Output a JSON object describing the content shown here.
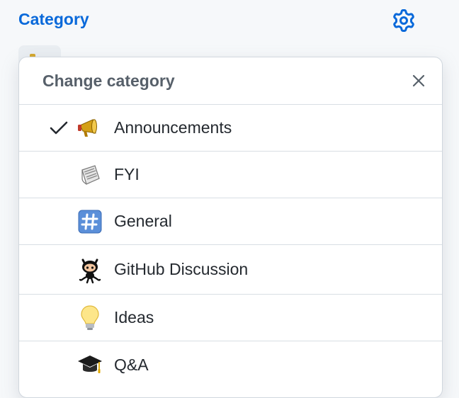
{
  "sidebar": {
    "heading": "Category"
  },
  "menu": {
    "title": "Change category",
    "items": [
      {
        "label": "Announcements",
        "emoji": "megaphone-icon",
        "selected": true
      },
      {
        "label": "FYI",
        "emoji": "newspaper-icon",
        "selected": false
      },
      {
        "label": "General",
        "emoji": "hash-keycap-icon",
        "selected": false
      },
      {
        "label": "GitHub Discussion",
        "emoji": "octocat-icon",
        "selected": false
      },
      {
        "label": "Ideas",
        "emoji": "light-bulb-icon",
        "selected": false
      },
      {
        "label": "Q&A",
        "emoji": "graduation-cap-icon",
        "selected": false
      }
    ]
  },
  "colors": {
    "accent": "#0969da",
    "text": "#24292f",
    "muted": "#57606a",
    "border": "#d0d7de"
  }
}
